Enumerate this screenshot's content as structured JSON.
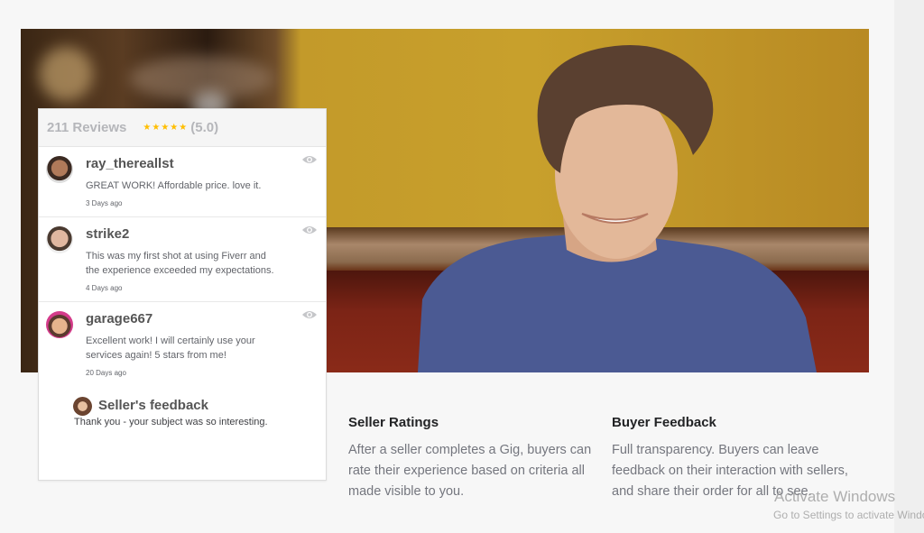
{
  "hero": {
    "image": "smiling-young-man-in-blue-tshirt-cafe-photo"
  },
  "reviews_card": {
    "count_label": "211 Reviews",
    "stars": "★★★★★",
    "rating": 5,
    "rating_label": "(5.0)",
    "colors": {
      "stars": "#ffbe00",
      "header_text": "#b5b6ba"
    },
    "reviews": [
      {
        "user": "ray_thereallst",
        "text": "GREAT WORK! Affordable price. love it.",
        "time": "3 Days ago",
        "icon": "eye-icon"
      },
      {
        "user": "strike2",
        "text": "This was my first shot at using Fiverr and the experience exceeded my expectations.",
        "time": "4 Days ago",
        "icon": "eye-icon"
      },
      {
        "user": "garage667",
        "text": "Excellent work! I will certainly use your services again! 5 stars from me!",
        "time": "20 Days ago",
        "icon": "eye-icon"
      }
    ],
    "seller_feedback": {
      "title": "Seller's feedback",
      "message": "Thank you - your subject was so interesting."
    }
  },
  "features": [
    {
      "title": "Seller Ratings",
      "text": "After a seller completes a Gig, buyers can rate their experience based on criteria all made visible to you."
    },
    {
      "title": "Buyer Feedback",
      "text": "Full transparency. Buyers can leave feedback on their interaction with sellers, and share their order for all to see."
    }
  ],
  "watermark": {
    "line1": "Activate Windows",
    "line2": "Go to Settings to activate Windows."
  }
}
